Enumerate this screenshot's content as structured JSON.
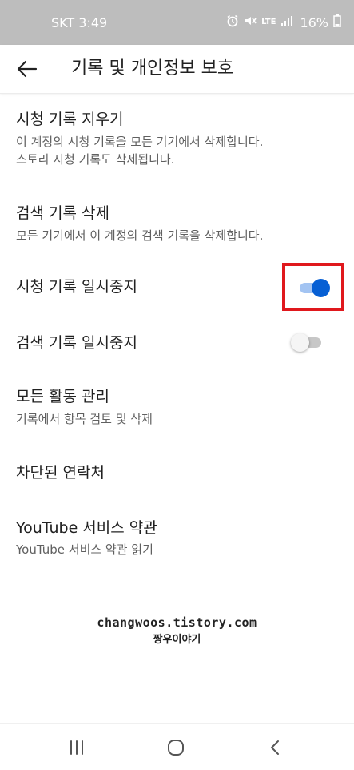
{
  "status_bar": {
    "carrier_time": "SKT 3:49",
    "network": "LTE",
    "battery": "16%",
    "icons": [
      "alarm-icon",
      "mute-icon",
      "lte-icon",
      "signal-icon",
      "battery-icon"
    ]
  },
  "header": {
    "title": "기록 및 개인정보 보호",
    "back_icon": "arrow-left-icon"
  },
  "settings": {
    "clear_watch_history": {
      "title": "시청 기록 지우기",
      "subtitle_line1": "이 계정의 시청 기록을 모든 기기에서 삭제합니다.",
      "subtitle_line2": "스토리 시청 기록도 삭제됩니다."
    },
    "clear_search_history": {
      "title": "검색 기록 삭제",
      "subtitle": "모든 기기에서 이 계정의 검색 기록을 삭제합니다."
    },
    "pause_watch_history": {
      "title": "시청 기록 일시중지",
      "enabled": true
    },
    "pause_search_history": {
      "title": "검색 기록 일시중지",
      "enabled": false
    },
    "manage_all_activity": {
      "title": "모든 활동 관리",
      "subtitle": "기록에서 항목 검토 및 삭제"
    },
    "blocked_contacts": {
      "title": "차단된 연락처"
    },
    "terms_of_service": {
      "title": "YouTube 서비스 약관",
      "subtitle": "YouTube 서비스 약관 읽기"
    }
  },
  "watermark": {
    "url": "changwoos.tistory.com",
    "name": "짱우이야기"
  },
  "nav_bar": {
    "icons": [
      "recent-apps-icon",
      "home-icon",
      "back-icon"
    ]
  },
  "colors": {
    "status_bar_bg": "#bdbdbd",
    "toggle_on_knob": "#065fd4",
    "toggle_on_track": "#a3c4f2",
    "toggle_off_knob": "#f5f5f5",
    "toggle_off_track": "#c7c7c7",
    "highlight": "#e0181d",
    "primary_text": "#212121",
    "secondary_text": "#606060"
  }
}
